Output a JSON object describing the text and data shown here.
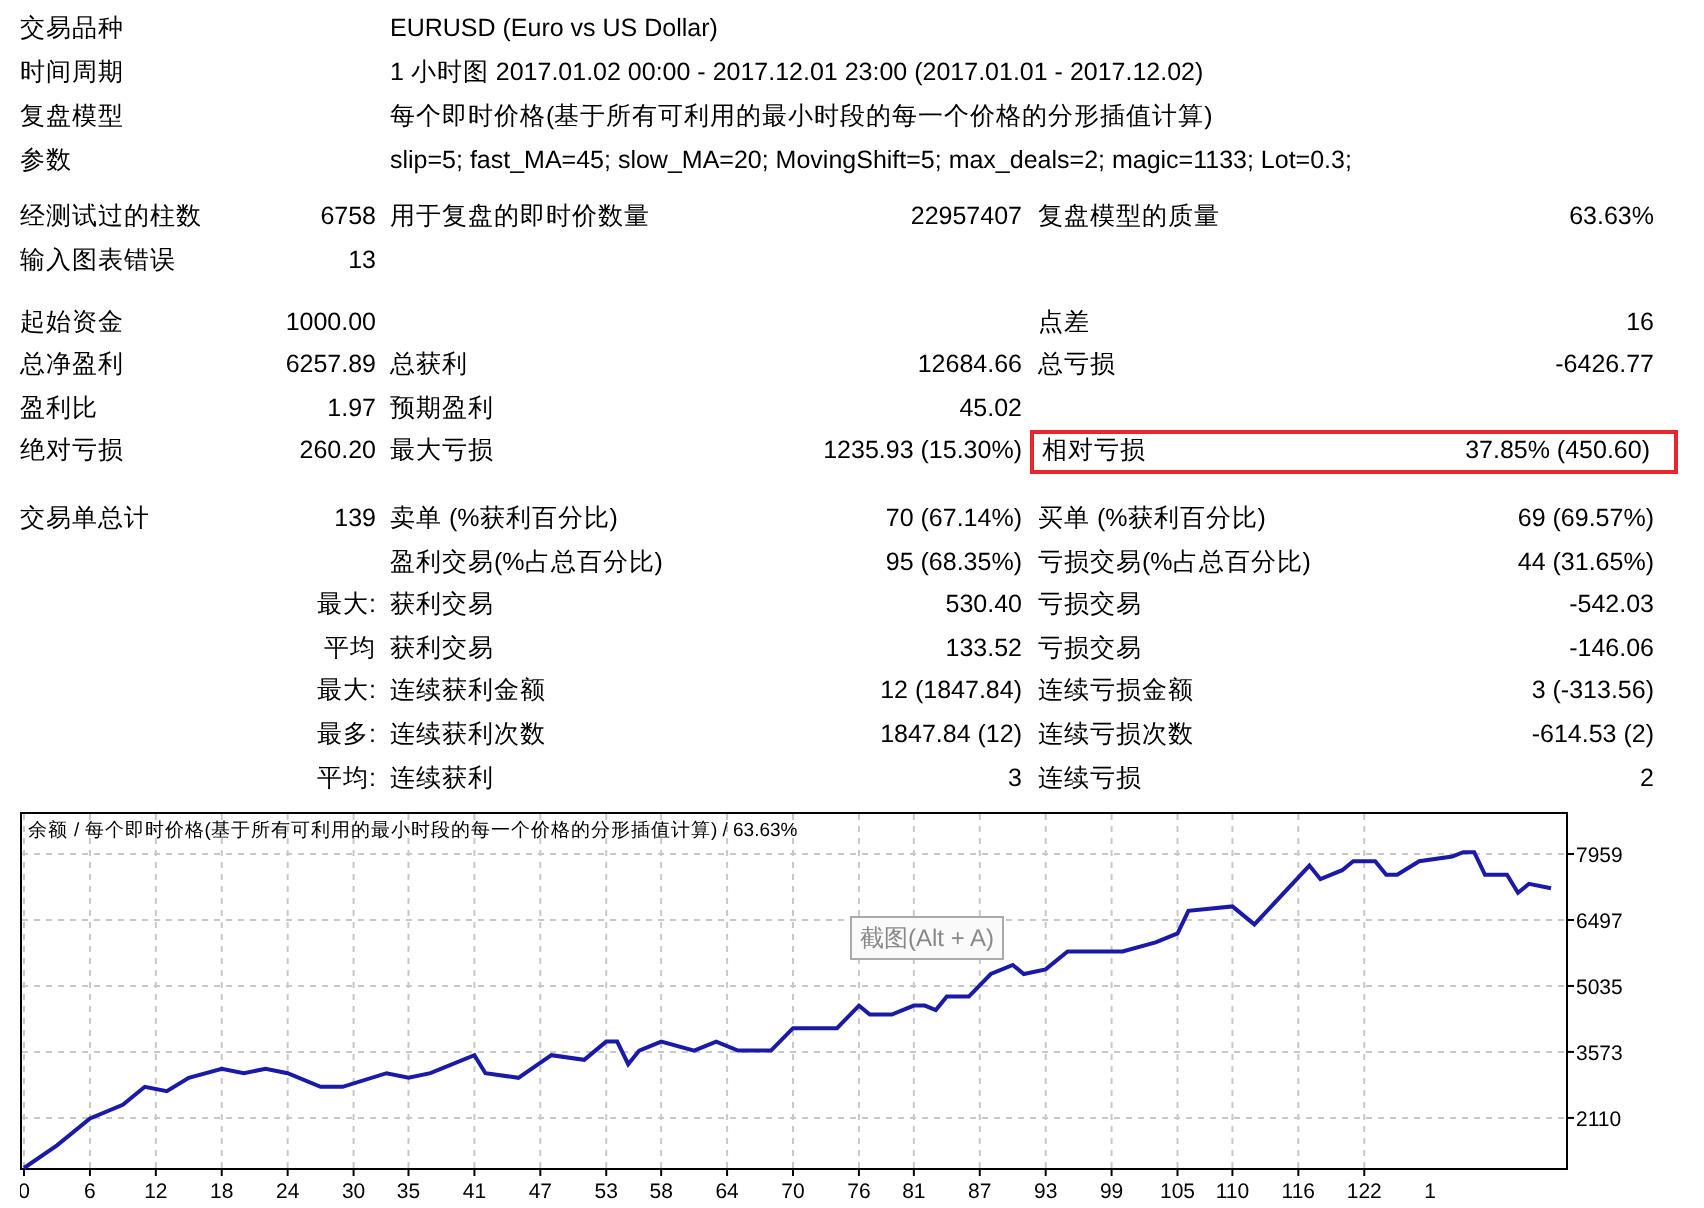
{
  "settings": [
    {
      "label": "交易品种",
      "value": "EURUSD (Euro vs US Dollar)"
    },
    {
      "label": "时间周期",
      "value": "1 小时图 2017.01.02 00:00 - 2017.12.01 23:00 (2017.01.01 - 2017.12.02)"
    },
    {
      "label": "复盘模型",
      "value": "每个即时价格(基于所有可利用的最小时段的每一个价格的分形插值计算)"
    },
    {
      "label": "参数",
      "value": "slip=5; fast_MA=45; slow_MA=20; MovingShift=5; max_deals=2; magic=1133; Lot=0.3;"
    }
  ],
  "stat_sections": [
    {
      "rows": [
        {
          "pairs": [
            {
              "label": "经测试过的柱数",
              "value": "6758",
              "highlighted": false
            },
            {
              "label": "用于复盘的即时价数量",
              "value": "22957407",
              "highlighted": false
            },
            {
              "label": "复盘模型的质量",
              "value": "63.63%",
              "highlighted": false
            }
          ]
        },
        {
          "pairs": [
            {
              "label": "输入图表错误",
              "value": "13",
              "highlighted": false
            },
            {
              "highlighted": false
            },
            {
              "highlighted": false
            }
          ]
        }
      ]
    },
    {
      "rows": [
        {
          "pairs": [
            {
              "label": "起始资金",
              "value": "1000.00",
              "highlighted": false
            },
            {
              "highlighted": false
            },
            {
              "label": "点差",
              "value": "16",
              "highlighted": false
            }
          ]
        },
        {
          "pairs": [
            {
              "label": "总净盈利",
              "value": "6257.89",
              "highlighted": false
            },
            {
              "label": "总获利",
              "value": "12684.66",
              "highlighted": false
            },
            {
              "label": "总亏损",
              "value": "-6426.77",
              "highlighted": false
            }
          ]
        },
        {
          "pairs": [
            {
              "label": "盈利比",
              "value": "1.97",
              "highlighted": false
            },
            {
              "label": "预期盈利",
              "value": "45.02",
              "highlighted": false
            },
            {
              "highlighted": false
            }
          ]
        },
        {
          "pairs": [
            {
              "label": "绝对亏损",
              "value": "260.20",
              "highlighted": false
            },
            {
              "label": "最大亏损",
              "value": "1235.93 (15.30%)",
              "highlighted": false
            },
            {
              "label": "相对亏损",
              "value": "37.85% (450.60)",
              "highlighted": true
            }
          ]
        }
      ]
    },
    {
      "rows": [
        {
          "pairs": [
            {
              "label": "交易单总计",
              "value": "139",
              "highlighted": false
            },
            {
              "label": "卖单 (%获利百分比)",
              "value": "70 (67.14%)",
              "highlighted": false
            },
            {
              "label": "买单 (%获利百分比)",
              "value": "69 (69.57%)",
              "highlighted": false
            }
          ]
        },
        {
          "pairs": [
            {
              "highlighted": false
            },
            {
              "label": "盈利交易(%占总百分比)",
              "value": "95 (68.35%)",
              "highlighted": false
            },
            {
              "label": "亏损交易(%占总百分比)",
              "value": "44 (31.65%)",
              "highlighted": false
            }
          ]
        },
        {
          "pairs": [
            {
              "value": "最大:",
              "highlighted": false
            },
            {
              "label": "获利交易",
              "value": "530.40",
              "highlighted": false
            },
            {
              "label": "亏损交易",
              "value": "-542.03",
              "highlighted": false
            }
          ]
        },
        {
          "pairs": [
            {
              "value": "平均",
              "highlighted": false
            },
            {
              "label": "获利交易",
              "value": "133.52",
              "highlighted": false
            },
            {
              "label": "亏损交易",
              "value": "-146.06",
              "highlighted": false
            }
          ]
        },
        {
          "pairs": [
            {
              "value": "最大:",
              "highlighted": false
            },
            {
              "label": "连续获利金额",
              "value": "12 (1847.84)",
              "highlighted": false
            },
            {
              "label": "连续亏损金额",
              "value": "3 (-313.56)",
              "highlighted": false
            }
          ]
        },
        {
          "pairs": [
            {
              "value": "最多:",
              "highlighted": false
            },
            {
              "label": "连续获利次数",
              "value": "1847.84 (12)",
              "highlighted": false
            },
            {
              "label": "连续亏损次数",
              "value": "-614.53 (2)",
              "highlighted": false
            }
          ]
        },
        {
          "pairs": [
            {
              "value": "平均:",
              "highlighted": false
            },
            {
              "label": "连续获利",
              "value": "3",
              "highlighted": false
            },
            {
              "label": "连续亏损",
              "value": "2",
              "highlighted": false
            }
          ]
        }
      ]
    }
  ],
  "balance_chart": {
    "chart_data": {
      "type": "line",
      "title": "/ 每个即时价格(基于所有可利用的最小时段的每一个价格的分形插值计算) / 63.63%",
      "grid": true,
      "xlim": [
        0,
        140
      ],
      "ylim": [
        1000,
        8890
      ],
      "x": [
        0,
        3,
        6,
        9,
        11,
        13,
        15,
        18,
        20,
        22,
        24,
        27,
        29,
        33,
        35,
        37,
        41,
        42,
        45,
        48,
        51,
        53,
        54,
        55,
        56,
        58,
        61,
        63,
        65,
        68,
        70,
        74,
        76,
        77,
        79,
        81,
        82,
        83,
        84,
        86,
        88,
        90,
        91,
        93,
        95,
        99,
        100,
        103,
        105,
        106,
        110,
        112,
        117,
        118,
        120,
        121,
        123,
        124,
        125,
        127,
        130,
        131,
        132,
        133,
        135,
        136,
        137,
        139
      ],
      "series": [
        {
          "name": "余额",
          "color": "#1a1aa8",
          "values": [
            1000,
            1500,
            2100,
            2400,
            2800,
            2700,
            3000,
            3200,
            3100,
            3200,
            3100,
            2800,
            2800,
            3100,
            3000,
            3100,
            3500,
            3100,
            3000,
            3500,
            3400,
            3800,
            3800,
            3300,
            3600,
            3800,
            3600,
            3800,
            3600,
            3600,
            4100,
            4100,
            4600,
            4400,
            4400,
            4600,
            4600,
            4500,
            4800,
            4800,
            5300,
            5500,
            5300,
            5400,
            5800,
            5800,
            5800,
            6000,
            6200,
            6700,
            6800,
            6400,
            7700,
            7400,
            7600,
            7800,
            7800,
            7500,
            7500,
            7800,
            7900,
            8000,
            8000,
            7500,
            7500,
            7100,
            7300,
            7200
          ]
        }
      ],
      "xticks": [
        0,
        6,
        12,
        18,
        24,
        30,
        35,
        41,
        47,
        53,
        58,
        64,
        70,
        76,
        81,
        87,
        93,
        99,
        105,
        110,
        116,
        122
      ],
      "yticks": [
        2110,
        3573,
        5035,
        6497,
        7959
      ]
    },
    "cut_tick_label": "1",
    "tooltip": "截图(Alt + A)"
  }
}
